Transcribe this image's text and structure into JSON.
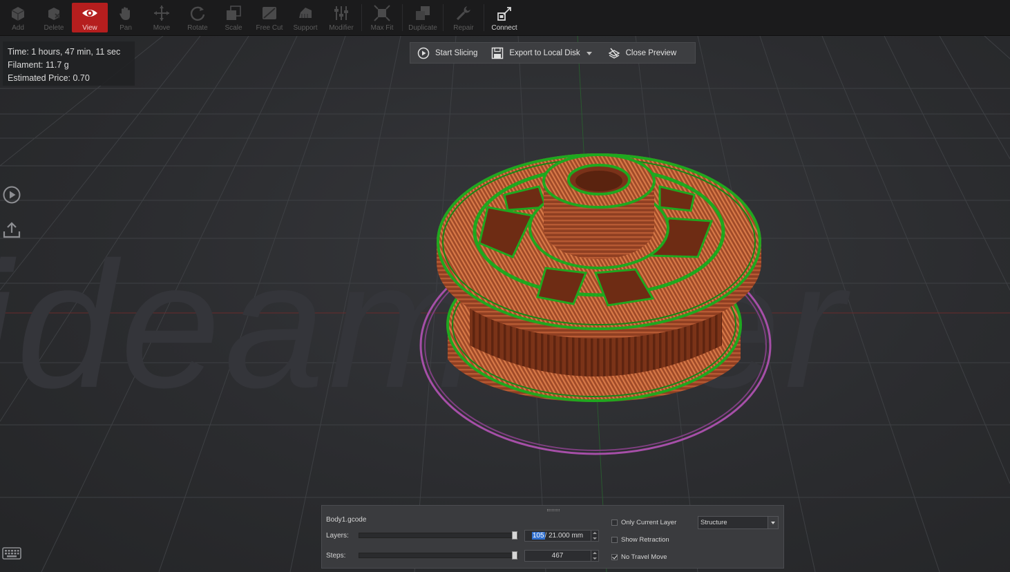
{
  "toolbar": {
    "items": [
      {
        "label": "Add",
        "icon": "add-icon"
      },
      {
        "label": "Delete",
        "icon": "delete-icon"
      },
      {
        "label": "View",
        "icon": "eye-icon"
      },
      {
        "label": "Pan",
        "icon": "hand-icon"
      },
      {
        "label": "Move",
        "icon": "move-icon"
      },
      {
        "label": "Rotate",
        "icon": "rotate-icon"
      },
      {
        "label": "Scale",
        "icon": "scale-icon"
      },
      {
        "label": "Free Cut",
        "icon": "free-cut-icon"
      },
      {
        "label": "Support",
        "icon": "support-icon"
      },
      {
        "label": "Modifier",
        "icon": "modifier-icon"
      },
      {
        "label": "Max Fit",
        "icon": "max-fit-icon"
      },
      {
        "label": "Duplicate",
        "icon": "duplicate-icon"
      },
      {
        "label": "Repair",
        "icon": "repair-icon"
      },
      {
        "label": "Connect",
        "icon": "connect-icon"
      }
    ],
    "active": "View",
    "accent_color": "#b51e1e"
  },
  "stats": {
    "time": "Time: 1 hours, 47 min, 11 sec",
    "filament": "Filament: 11.7 g",
    "price": "Estimated Price: 0.70"
  },
  "actions": {
    "start_slicing": "Start Slicing",
    "export": "Export to Local Disk",
    "close_preview": "Close Preview"
  },
  "watermark": "ideamaker",
  "colors": {
    "wall": "#b0532f",
    "infill": "#2ab32a",
    "skirt": "#a64fa8"
  },
  "panel": {
    "file_name": "Body1.gcode",
    "layers_label": "Layers:",
    "layers_selected": "105",
    "layers_rest": " / 21.000 mm",
    "layers_level": 1.0,
    "steps_label": "Steps:",
    "steps_value": "467",
    "steps_level": 1.0,
    "only_current_layer": {
      "label": "Only Current Layer",
      "checked": false
    },
    "show_retraction": {
      "label": "Show Retraction",
      "checked": false
    },
    "no_travel_move": {
      "label": "No Travel Move",
      "checked": true
    },
    "view_mode": "Structure"
  }
}
